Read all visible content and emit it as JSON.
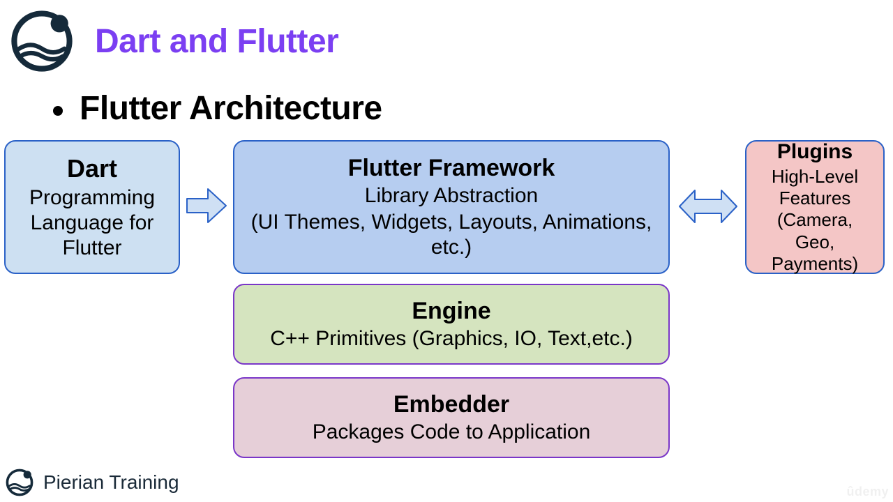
{
  "title": "Dart and Flutter",
  "heading": "Flutter Architecture",
  "footer": "Pierian Training",
  "watermark": "ûdemy",
  "boxes": {
    "dart": {
      "title": "Dart",
      "body": "Programming Language for Flutter"
    },
    "framework": {
      "title": "Flutter Framework",
      "line1": "Library Abstraction",
      "line2": "(UI Themes, Widgets, Layouts, Animations, etc.)"
    },
    "plugins": {
      "title": "Plugins",
      "body": "High-Level Features (Camera, Geo, Payments)"
    },
    "engine": {
      "title": "Engine",
      "body": "C++ Primitives (Graphics, IO, Text,etc.)"
    },
    "embedder": {
      "title": "Embedder",
      "body": "Packages Code to Application"
    }
  }
}
